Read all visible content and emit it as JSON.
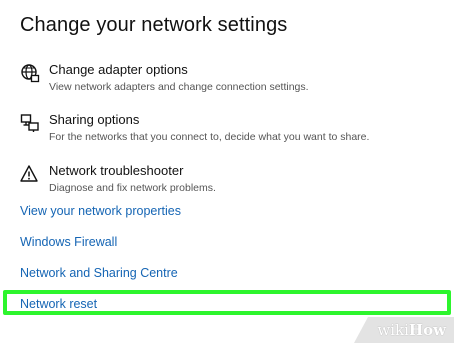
{
  "page": {
    "title": "Change your network settings"
  },
  "options": [
    {
      "title": "Change adapter options",
      "description": "View network adapters and change connection settings.",
      "icon": "globe-icon"
    },
    {
      "title": "Sharing options",
      "description": "For the networks that you connect to, decide what you want to share.",
      "icon": "sharing-icon"
    },
    {
      "title": "Network troubleshooter",
      "description": "Diagnose and fix network problems.",
      "icon": "warning-icon"
    }
  ],
  "links": [
    "View your network properties",
    "Windows Firewall",
    "Network and Sharing Centre",
    "Network reset"
  ],
  "highlight": {
    "target": "Network reset",
    "color": "#2df52d"
  },
  "colors": {
    "link": "#1565b4",
    "text": "#111111",
    "description": "#555555"
  },
  "watermark": {
    "prefix": "wiki",
    "suffix": "How"
  }
}
